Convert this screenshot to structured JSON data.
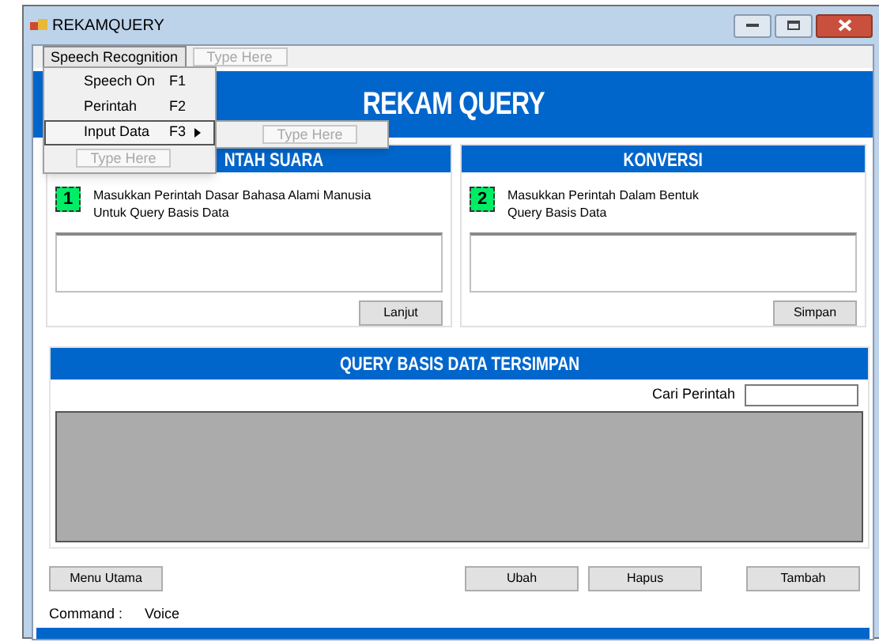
{
  "window": {
    "title": "REKAMQUERY"
  },
  "menu_bar": {
    "items": [
      {
        "label": "Speech Recognition",
        "selected": true
      }
    ],
    "placeholder": "Type Here"
  },
  "dropdown": {
    "items": [
      {
        "label": "Speech On",
        "shortcut": "F1",
        "selected": false,
        "has_submenu": false
      },
      {
        "label": "Perintah",
        "shortcut": "F2",
        "selected": false,
        "has_submenu": false
      },
      {
        "label": "Input Data",
        "shortcut": "F3",
        "selected": true,
        "has_submenu": true
      }
    ],
    "placeholder": "Type Here"
  },
  "submenu": {
    "placeholder": "Type Here"
  },
  "header": {
    "title": "REKAM QUERY"
  },
  "panels": [
    {
      "title": "NTAH SUARA",
      "step": "1",
      "instruction": "Masukkan Perintah Dasar Bahasa Alami Manusia\nUntuk Query Basis Data",
      "button": "Lanjut"
    },
    {
      "title": "KONVERSI",
      "step": "2",
      "instruction": "Masukkan Perintah Dalam Bentuk\nQuery Basis Data",
      "button": "Simpan"
    }
  ],
  "saved_queries": {
    "title": "QUERY BASIS DATA TERSIMPAN",
    "search_label": "Cari Perintah"
  },
  "buttons": [
    {
      "label": "Menu Utama"
    },
    {
      "label": "Ubah"
    },
    {
      "label": "Hapus"
    },
    {
      "label": "Tambah"
    }
  ],
  "status": {
    "label": "Command :",
    "value": "Voice"
  }
}
